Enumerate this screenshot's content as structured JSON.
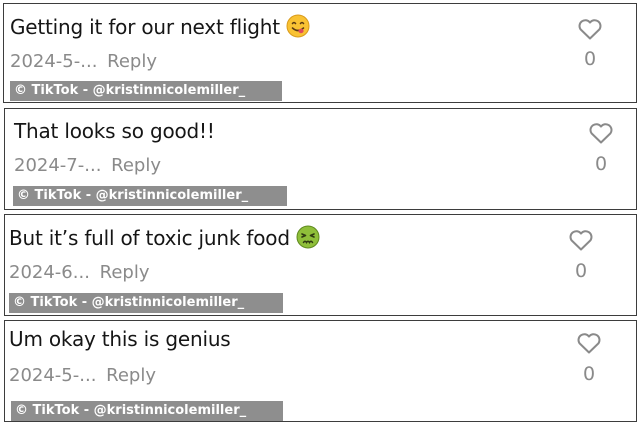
{
  "comments": [
    {
      "text": "Getting it for our next flight",
      "emoji": "yum-face",
      "date": "2024-5-...",
      "reply": "Reply",
      "likes": "0",
      "watermark": "© TikTok - @kristinnicolemiller_"
    },
    {
      "text": "That looks so good!!",
      "emoji": "",
      "date": "2024-7-...",
      "reply": "Reply",
      "likes": "0",
      "watermark": "© TikTok - @kristinnicolemiller_"
    },
    {
      "text": "But it’s full of toxic junk food",
      "emoji": "nauseated-face",
      "date": "2024-6...",
      "reply": "Reply",
      "likes": "0",
      "watermark": "© TikTok - @kristinnicolemiller_"
    },
    {
      "text": "Um okay this is genius",
      "emoji": "",
      "date": "2024-5-...",
      "reply": "Reply",
      "likes": "0",
      "watermark": "© TikTok - @kristinnicolemiller_"
    }
  ],
  "icons": {
    "like": "heart-outline-icon"
  },
  "colors": {
    "border": "#3d3d3d",
    "text": "#161616",
    "muted": "#8a8a8a",
    "watermark_bg": "#8e8e8e"
  }
}
